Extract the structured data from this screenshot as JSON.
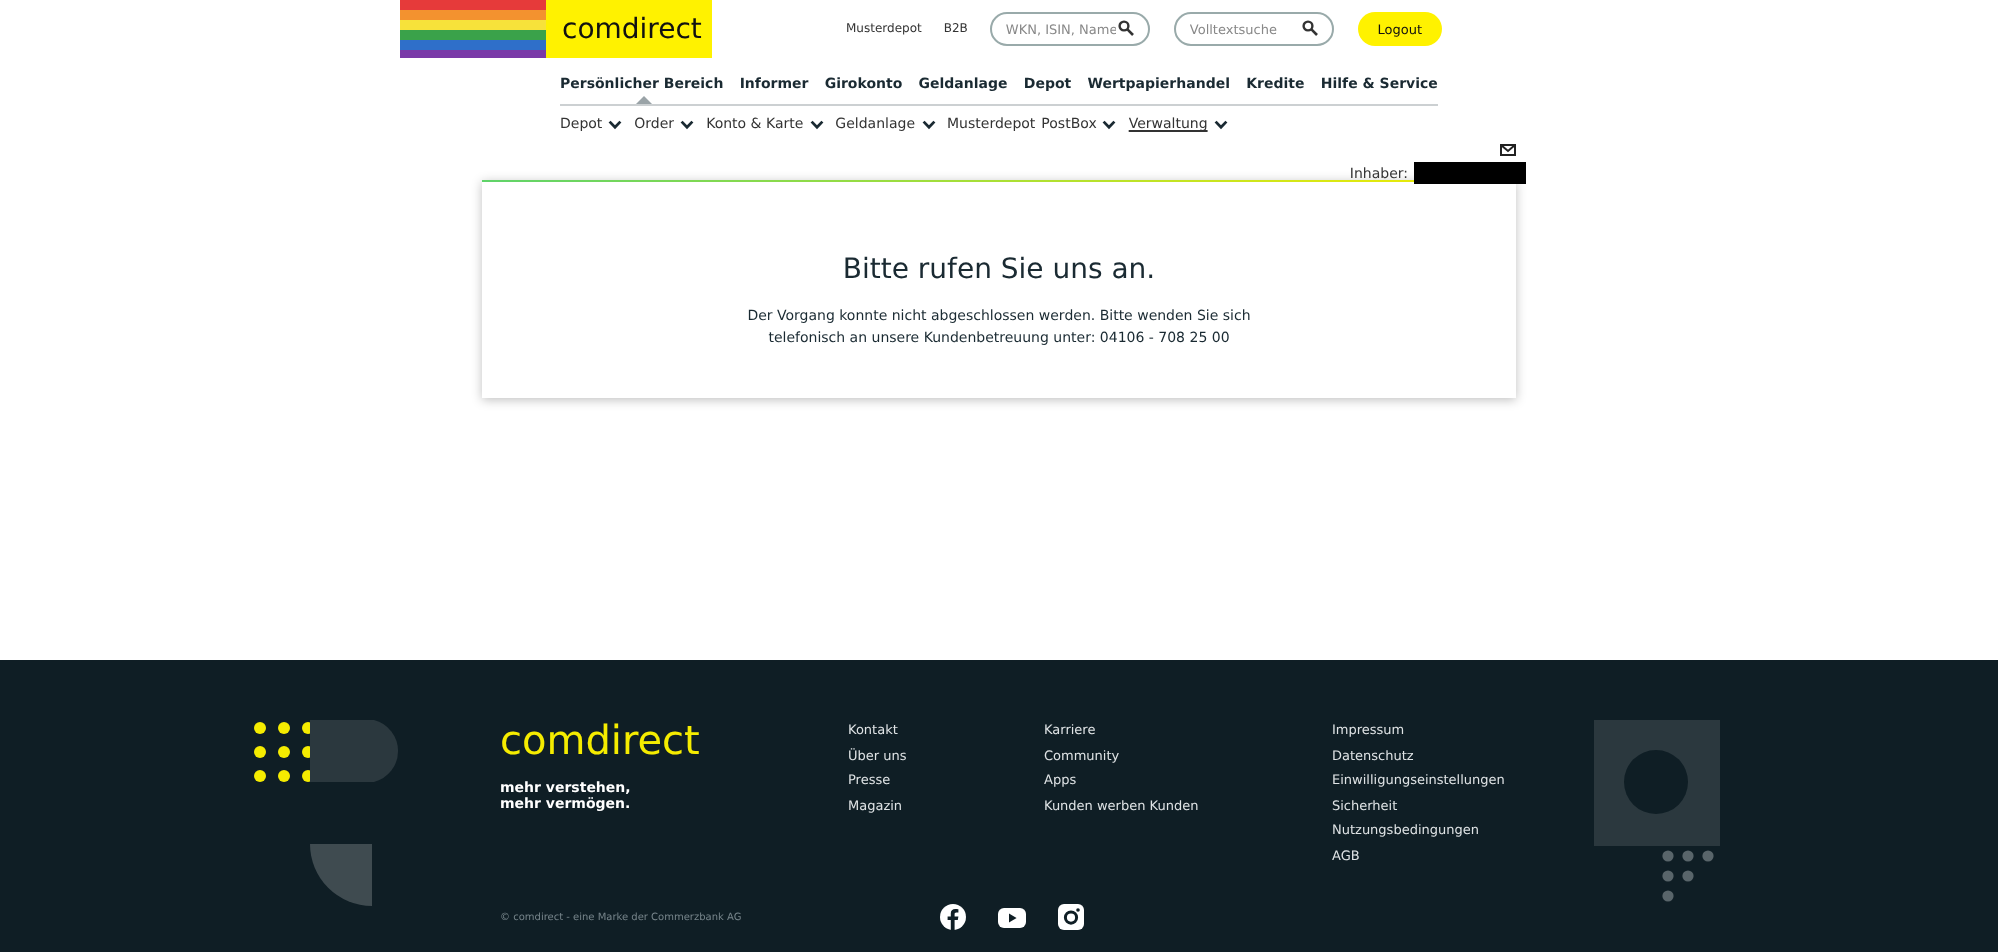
{
  "header": {
    "logo_text": "comdirect",
    "top_links": [
      "Musterdepot",
      "B2B"
    ],
    "search": {
      "placeholder": "WKN, ISIN, Name"
    },
    "fulltext_search": {
      "placeholder": "Volltextsuche"
    },
    "logout": "Logout"
  },
  "main_nav": [
    {
      "label": "Persönlicher Bereich",
      "selected": true
    },
    {
      "label": "Informer",
      "selected": false
    },
    {
      "label": "Girokonto",
      "selected": false
    },
    {
      "label": "Geldanlage",
      "selected": false
    },
    {
      "label": "Depot",
      "selected": false
    },
    {
      "label": "Wertpapierhandel",
      "selected": false
    },
    {
      "label": "Kredite",
      "selected": false
    },
    {
      "label": "Hilfe & Service",
      "selected": false
    }
  ],
  "sub_nav": [
    {
      "label": "Depot",
      "selected": false,
      "has_menu": true
    },
    {
      "label": "Order",
      "selected": false,
      "has_menu": true
    },
    {
      "label": "Konto & Karte",
      "selected": false,
      "has_menu": true
    },
    {
      "label": "Geldanlage",
      "selected": false,
      "has_menu": true
    },
    {
      "label": "Musterdepot",
      "selected": false,
      "has_menu": false
    },
    {
      "label": "PostBox",
      "selected": false,
      "has_menu": true
    },
    {
      "label": "Verwaltung",
      "selected": true,
      "has_menu": true
    }
  ],
  "owner_label": "Inhaber:",
  "card": {
    "title": "Bitte rufen Sie uns an.",
    "message": "Der Vorgang konnte nicht abgeschlossen werden. Bitte wenden Sie sich telefonisch an unsere Kundenbetreuung unter: 04106 - 708 25 00"
  },
  "footer": {
    "logo_text": "comdirect",
    "tagline": "mehr verstehen,\nmehr vermögen.",
    "link_columns": [
      [
        "Kontakt",
        "Über uns",
        "Presse",
        "Magazin"
      ],
      [
        "Karriere",
        "Community",
        "Apps",
        "Kunden werben Kunden"
      ],
      [
        "Impressum",
        "Datenschutz",
        "Einwilligungseinstellungen",
        "Sicherheit",
        "Nutzungsbedingungen",
        "AGB"
      ]
    ],
    "copyright": "© comdirect - eine Marke der Commerzbank AG",
    "social_links": [
      {
        "kind": "facebook"
      },
      {
        "kind": "youtube"
      },
      {
        "kind": "instagram"
      }
    ]
  }
}
